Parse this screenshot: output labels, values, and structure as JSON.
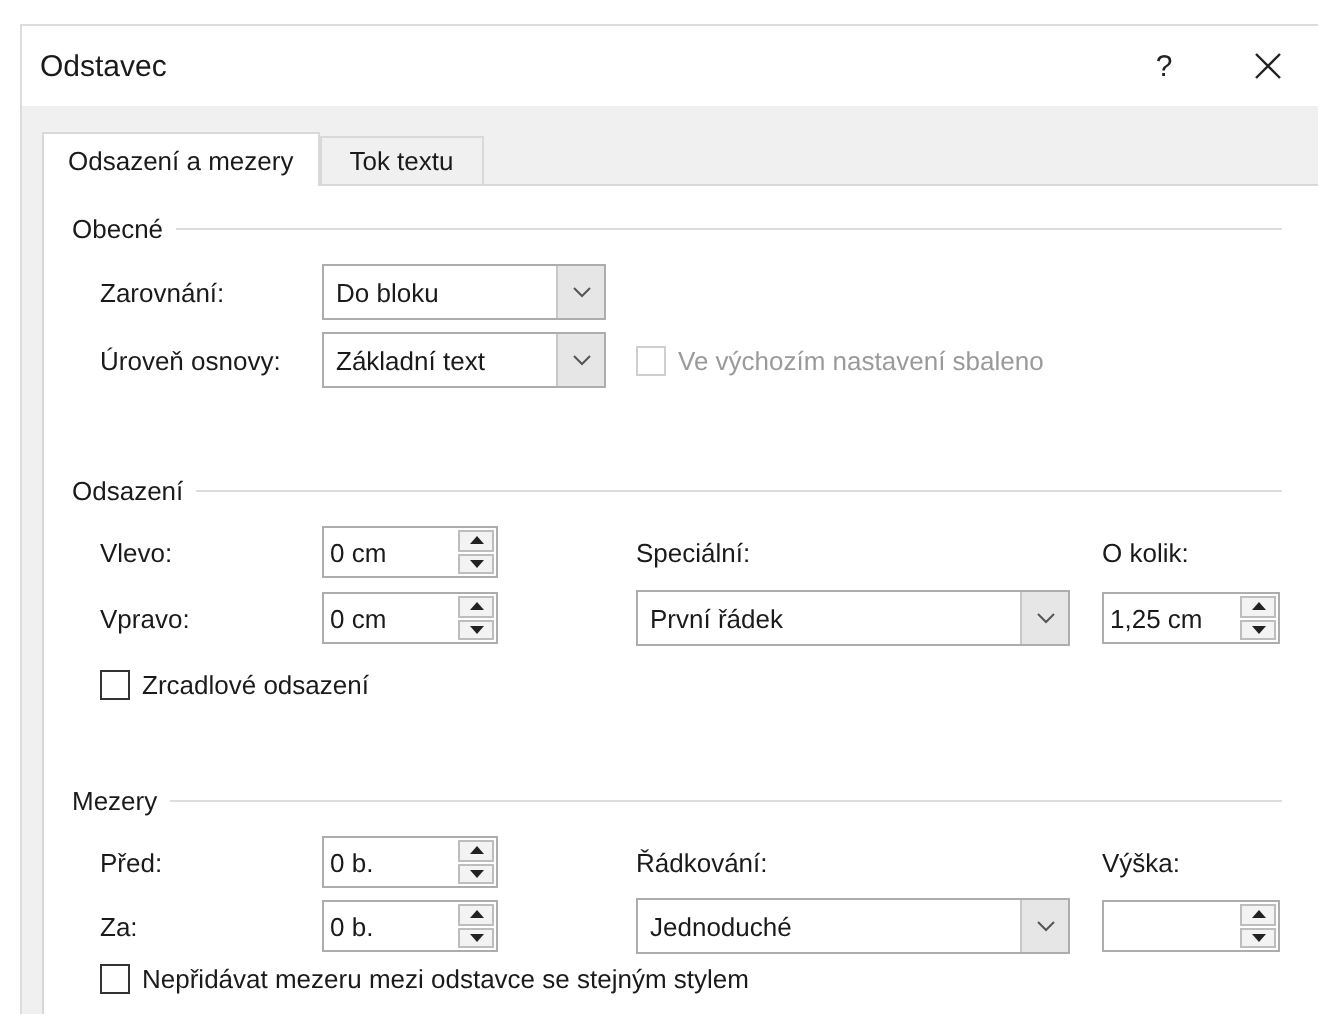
{
  "window": {
    "title": "Odstavec",
    "help": "?"
  },
  "tabs": [
    {
      "label": "Odsazení a mezery",
      "selected": true
    },
    {
      "label": "Tok textu",
      "selected": false
    }
  ],
  "general": {
    "title": "Obecné",
    "alignment": {
      "label": "Zarovnání:",
      "value": "Do bloku"
    },
    "outline_level": {
      "label": "Úroveň osnovy:",
      "value": "Základní text"
    },
    "collapsed": {
      "label": "Ve výchozím nastavení sbaleno",
      "checked": false,
      "disabled": true
    }
  },
  "indent": {
    "title": "Odsazení",
    "left": {
      "label": "Vlevo:",
      "value": "0 cm"
    },
    "right": {
      "label": "Vpravo:",
      "value": "0 cm"
    },
    "special": {
      "label": "Speciální:",
      "value": "První řádek"
    },
    "by": {
      "label": "O kolik:",
      "value": "1,25 cm"
    },
    "mirror": {
      "label": "Zrcadlové odsazení",
      "checked": false,
      "disabled": false
    }
  },
  "spacing": {
    "title": "Mezery",
    "before": {
      "label": "Před:",
      "value": "0 b."
    },
    "after": {
      "label": "Za:",
      "value": "0 b."
    },
    "line_spacing": {
      "label": "Řádkování:",
      "value": "Jednoduché"
    },
    "at": {
      "label": "Výška:"
    },
    "no_space": {
      "label": "Nepřidávat mezeru mezi odstavce se stejným stylem",
      "checked": false,
      "disabled": false
    }
  }
}
